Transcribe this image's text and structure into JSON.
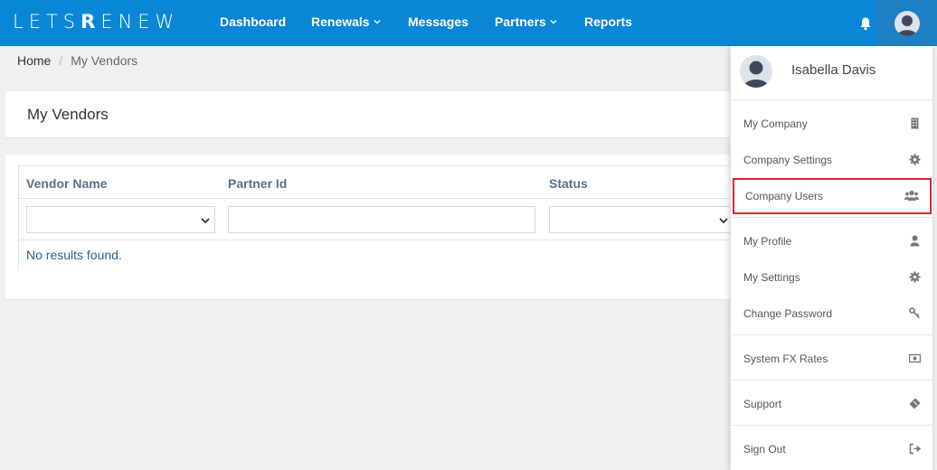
{
  "brand": {
    "logo_text_1": "LETS",
    "logo_text_2": "R",
    "logo_text_3": "ENEW"
  },
  "nav": {
    "items": [
      {
        "label": "Dashboard",
        "has_chevron": false
      },
      {
        "label": "Renewals",
        "has_chevron": true
      },
      {
        "label": "Messages",
        "has_chevron": false
      },
      {
        "label": "Partners",
        "has_chevron": true
      },
      {
        "label": "Reports",
        "has_chevron": false
      }
    ],
    "icons": {
      "notifications": "bell-icon",
      "user": "user-avatar-icon"
    }
  },
  "breadcrumb": {
    "home": "Home",
    "separator": "/",
    "current": "My Vendors"
  },
  "page": {
    "title": "My Vendors"
  },
  "table": {
    "columns": [
      "Vendor Name",
      "Partner Id",
      "Status"
    ],
    "filters": {
      "vendor_name": "",
      "partner_id": "",
      "status": ""
    },
    "empty_message": "No results found."
  },
  "user_menu": {
    "user_name": "Isabella Davis",
    "items": [
      {
        "label": "My Company",
        "icon": "building-icon"
      },
      {
        "label": "Company Settings",
        "icon": "gear-icon"
      },
      {
        "label": "Company Users",
        "icon": "users-icon",
        "highlighted": true
      },
      {
        "label": "My Profile",
        "icon": "user-icon"
      },
      {
        "label": "My Settings",
        "icon": "gear-icon"
      },
      {
        "label": "Change Password",
        "icon": "key-icon"
      },
      {
        "label": "System FX Rates",
        "icon": "money-icon"
      },
      {
        "label": "Support",
        "icon": "ticket-icon"
      },
      {
        "label": "Sign Out",
        "icon": "sign-out-icon"
      }
    ]
  },
  "colors": {
    "navbar": "#0a86d6",
    "highlight_border": "#d42a2f",
    "header_text": "#5d6f87",
    "link": "#2a6496"
  }
}
